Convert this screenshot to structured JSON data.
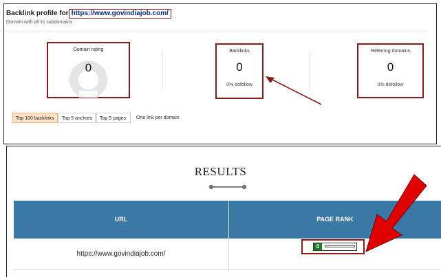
{
  "backlink_profile": {
    "title_prefix": "Backlink profile for",
    "url": "https://www.govindiajob.com/",
    "subtitle": "Domain with all its subdomains",
    "domain_rating": {
      "label": "Domain rating",
      "value": "0"
    },
    "backlinks": {
      "label": "Backlinks",
      "value": "0",
      "sub": "0% dofollow"
    },
    "referring_domains": {
      "label": "Referring domains",
      "value": "0",
      "sub": "0% dofollow"
    },
    "tabs": [
      {
        "label": "Top 100 backlinks",
        "active": true
      },
      {
        "label": "Top 5 anchors",
        "active": false
      },
      {
        "label": "Top 5 pages",
        "active": false
      }
    ],
    "tabs_note": "One link per domain"
  },
  "results": {
    "title": "RESULTS",
    "columns": [
      "URL",
      "PAGE RANK"
    ],
    "rows": [
      {
        "url": "https://www.govindiajob.com/",
        "page_rank": "0"
      }
    ]
  },
  "colors": {
    "table_header": "#3a78a6",
    "highlight_border": "#8b1a1a",
    "arrow": "#e00000",
    "rank_badge": "#1f7a2a",
    "active_tab": "#fbe3c7"
  },
  "icons": [
    "gauge-ring",
    "annotation-arrow",
    "divider-dots"
  ]
}
